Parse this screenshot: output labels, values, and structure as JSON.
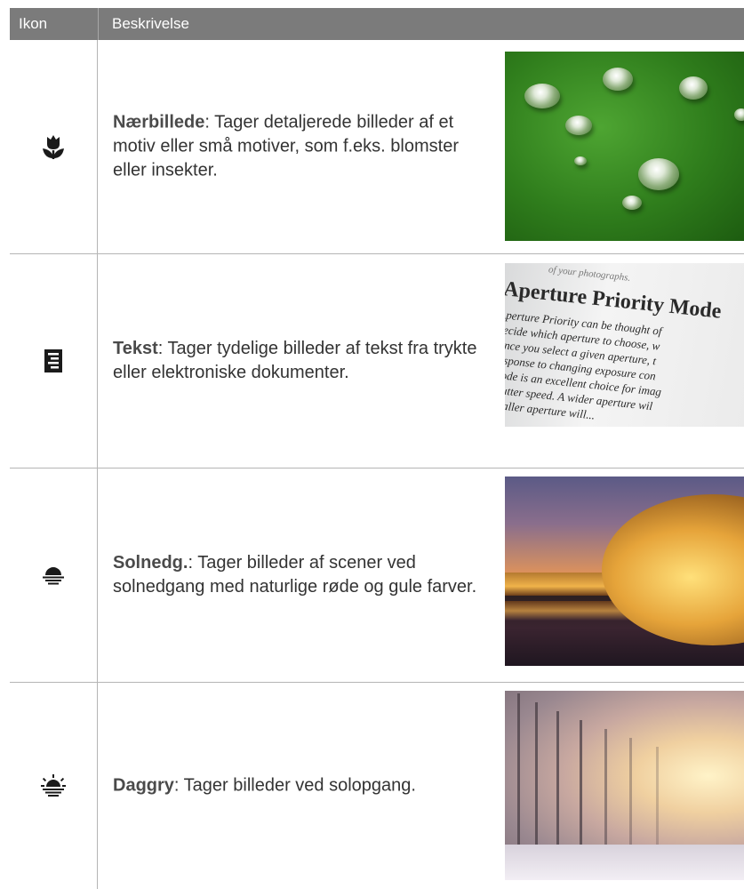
{
  "table": {
    "headers": {
      "icon": "Ikon",
      "description": "Beskrivelse"
    },
    "rows": [
      {
        "icon": "macro-flower-icon",
        "term": "Nærbillede",
        "separator": ": ",
        "text": "Tager detaljerede billeder af et motiv eller små motiver, som f.eks. blomster eller insekter.",
        "photo": "water-drops-on-leaf"
      },
      {
        "icon": "text-document-icon",
        "term": "Tekst",
        "separator": ": ",
        "text": "Tager tydelige billeder af tekst fra trykte eller elektroniske dokumenter.",
        "photo": "printed-book-page"
      },
      {
        "icon": "sunset-icon",
        "term": "Solnedg.",
        "separator": ": ",
        "text": "Tager billeder af scener ved solnedgang med naturlige røde og gule farver.",
        "photo": "sunset-over-water"
      },
      {
        "icon": "dawn-icon",
        "term": "Daggry",
        "separator": ": ",
        "text": "Tager billeder ved solopgang.",
        "photo": "foggy-sunrise-trees"
      }
    ]
  },
  "photo_text": {
    "top": "of your photographs.",
    "title": "Aperture Priority Mode",
    "lines": [
      "Aperture Priority can be thought of",
      "decide which aperture to choose, w",
      "Once you select a given aperture, t",
      "response to changing exposure con",
      "mode is an excellent choice for imag",
      "shutter speed. A wider aperture wil",
      "smaller aperture will..."
    ]
  }
}
